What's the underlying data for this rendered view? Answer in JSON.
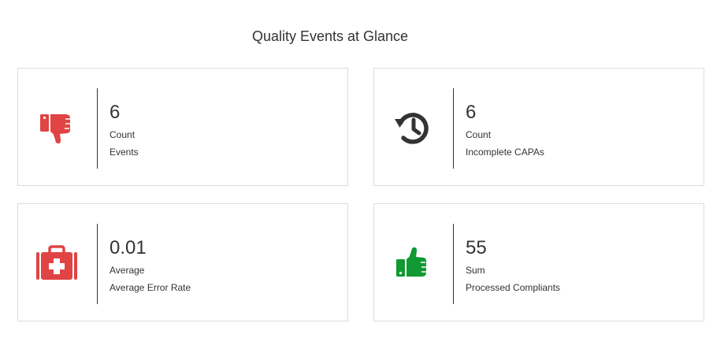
{
  "page": {
    "title": "Quality Events at Glance"
  },
  "cards": [
    {
      "value": "6",
      "aggregate": "Count",
      "label": "Events",
      "icon": "thumbs-down-icon",
      "icon_color": "#e04444"
    },
    {
      "value": "6",
      "aggregate": "Count",
      "label": "Incomplete CAPAs",
      "icon": "history-icon",
      "icon_color": "#333333"
    },
    {
      "value": "0.01",
      "aggregate": "Average",
      "label": "Average Error Rate",
      "icon": "first-aid-kit-icon",
      "icon_color": "#e04444"
    },
    {
      "value": "55",
      "aggregate": "Sum",
      "label": "Processed Compliants",
      "icon": "thumbs-up-icon",
      "icon_color": "#119933"
    }
  ]
}
